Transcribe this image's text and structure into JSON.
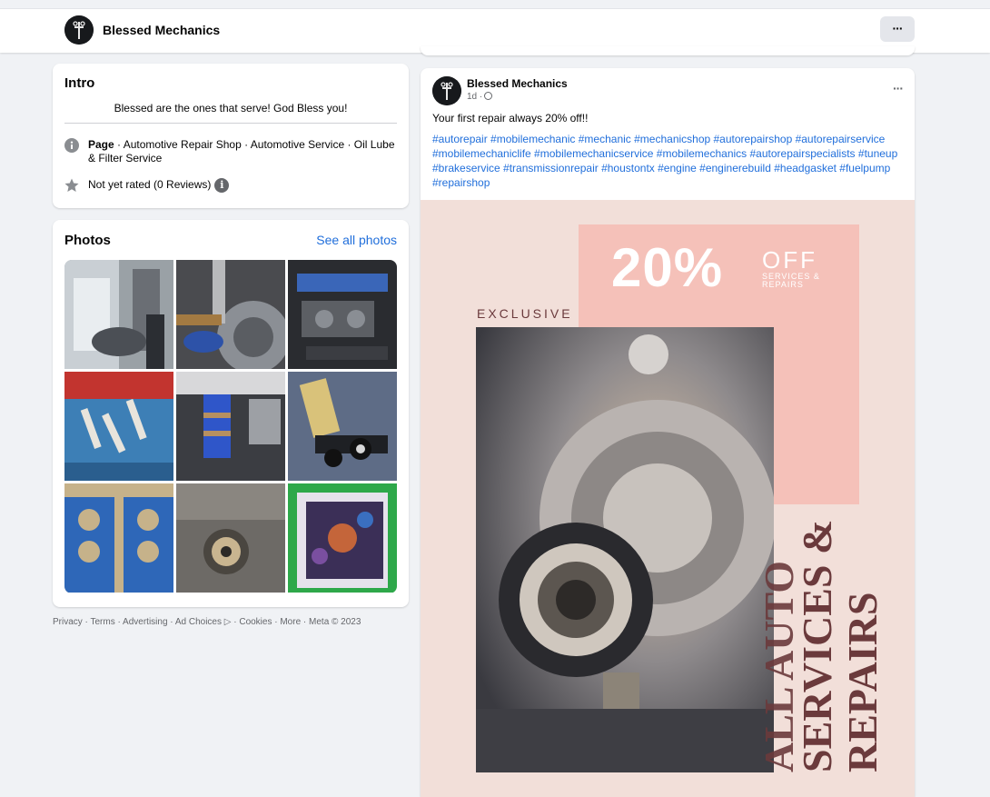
{
  "header": {
    "page_name": "Blessed Mechanics",
    "more_label": "···"
  },
  "intro": {
    "title": "Intro",
    "bio": "Blessed are the ones that serve! God Bless you!",
    "page_label": "Page",
    "page_categories": " · Automotive Repair Shop · Automotive Service · Oil Lube & Filter Service",
    "rating": "Not yet rated (0 Reviews)",
    "info_icon": "i"
  },
  "photos": {
    "title": "Photos",
    "see_all": "See all photos",
    "items": [
      {
        "subject": "suspension-strut"
      },
      {
        "subject": "brake-assembly"
      },
      {
        "subject": "engine-bay"
      },
      {
        "subject": "spark-plugs"
      },
      {
        "subject": "coilover-spring"
      },
      {
        "subject": "control-arm"
      },
      {
        "subject": "head-gaskets"
      },
      {
        "subject": "engine-mount"
      },
      {
        "subject": "timing-cover"
      }
    ]
  },
  "footer": {
    "links": "Privacy · Terms · Advertising · Ad Choices ▷ · Cookies · More · Meta © 2023"
  },
  "post": {
    "author": "Blessed Mechanics",
    "time": "1d ·",
    "menu": "···",
    "text": "Your first repair always 20% off!!",
    "hashtags": "#autorepair #mobilemechanic #mechanic #mechanicshop #autorepairshop #autorepairservice #mobilemechaniclife #mobilemechanicservice #mobilemechanics #autorepairspecialists #tuneup #brakeservice #transmissionrepair #houstontx #engine #enginerebuild #headgasket #fuelpump #repairshop",
    "image": {
      "percent": "20%",
      "off": "OFF",
      "off_sub": "SERVICES & REPAIRS",
      "exclusive": "EXCLUSIVE",
      "line1": "ALL AUTO",
      "line2": "SERVICES &",
      "line3": "REPAIRS"
    }
  },
  "colors": {
    "link": "#216fdb",
    "promo_pink": "#f5c1b9",
    "promo_bg": "#f2dfd9",
    "promo_text": "#6b3a3c"
  }
}
